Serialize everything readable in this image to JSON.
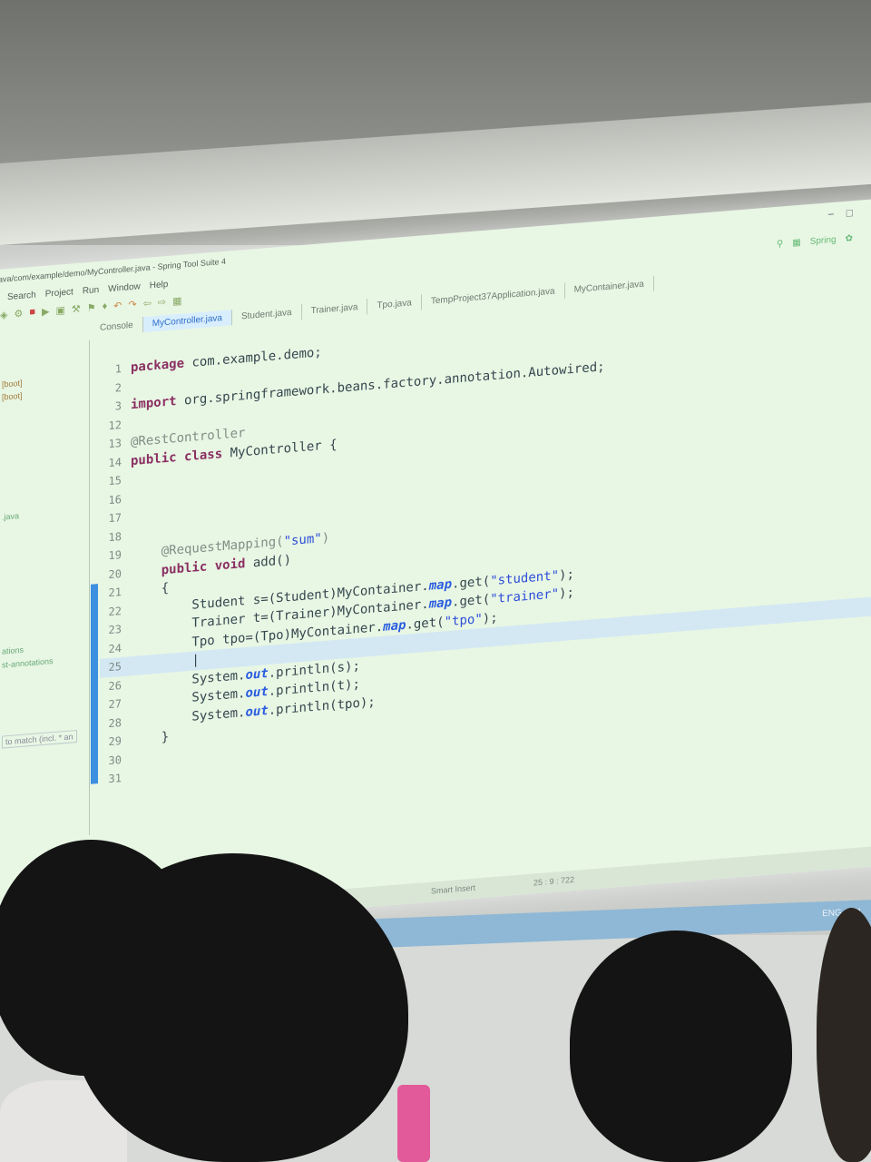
{
  "window": {
    "title": "ava/com/example/demo/MyController.java - Spring Tool Suite 4",
    "window_controls": [
      "−",
      "□"
    ]
  },
  "menu": [
    "Search",
    "Project",
    "Run",
    "Window",
    "Help"
  ],
  "perspective": {
    "label": "Spring",
    "icons": [
      "search-icon",
      "layout-icon",
      "spring-icon"
    ]
  },
  "tabs": [
    {
      "label": "Console",
      "active": false
    },
    {
      "label": "MyController.java",
      "active": true
    },
    {
      "label": "Student.java",
      "active": false
    },
    {
      "label": "Trainer.java",
      "active": false
    },
    {
      "label": "Tpo.java",
      "active": false
    },
    {
      "label": "TempProject37Application.java",
      "active": false
    },
    {
      "label": "MyContainer.java",
      "active": false
    }
  ],
  "left_panel": {
    "items": [
      "[boot]",
      "[boot]",
      ".java",
      "ations",
      "st-annotations"
    ],
    "filter_placeholder": "to match (incl. * an"
  },
  "code": {
    "lines": [
      {
        "n": "1",
        "tokens": [
          [
            "kw",
            "package"
          ],
          [
            "txt",
            " com.example.demo;"
          ]
        ]
      },
      {
        "n": "2",
        "tokens": []
      },
      {
        "n": "3",
        "tokens": [
          [
            "kw",
            "import"
          ],
          [
            "txt",
            " org.springframework.beans.factory.annotation.Autowired;"
          ]
        ]
      },
      {
        "n": "12",
        "tokens": []
      },
      {
        "n": "13",
        "tokens": [
          [
            "ann",
            "@RestController"
          ]
        ]
      },
      {
        "n": "14",
        "tokens": [
          [
            "kw",
            "public class"
          ],
          [
            "txt",
            " MyController {"
          ]
        ]
      },
      {
        "n": "15",
        "tokens": []
      },
      {
        "n": "16",
        "tokens": []
      },
      {
        "n": "17",
        "tokens": []
      },
      {
        "n": "18",
        "tokens": []
      },
      {
        "n": "19",
        "tokens": [
          [
            "txt",
            "    "
          ],
          [
            "ann",
            "@RequestMapping("
          ],
          [
            "str",
            "\"sum\""
          ],
          [
            "ann",
            ")"
          ]
        ]
      },
      {
        "n": "20",
        "tokens": [
          [
            "txt",
            "    "
          ],
          [
            "kw",
            "public void"
          ],
          [
            "txt",
            " add()"
          ]
        ]
      },
      {
        "n": "21",
        "tokens": [
          [
            "txt",
            "    {"
          ]
        ]
      },
      {
        "n": "22",
        "tokens": [
          [
            "txt",
            "        Student s=(Student)MyContainer."
          ],
          [
            "fld",
            "map"
          ],
          [
            "txt",
            ".get("
          ],
          [
            "str",
            "\"student\""
          ],
          [
            "txt",
            ");"
          ]
        ]
      },
      {
        "n": "23",
        "tokens": [
          [
            "txt",
            "        Trainer t=(Trainer)MyContainer."
          ],
          [
            "fld",
            "map"
          ],
          [
            "txt",
            ".get("
          ],
          [
            "str",
            "\"trainer\""
          ],
          [
            "txt",
            ");"
          ]
        ]
      },
      {
        "n": "24",
        "tokens": [
          [
            "txt",
            "        Tpo tpo=(Tpo)MyContainer."
          ],
          [
            "fld",
            "map"
          ],
          [
            "txt",
            ".get("
          ],
          [
            "str",
            "\"tpo\""
          ],
          [
            "txt",
            ");"
          ]
        ]
      },
      {
        "n": "25",
        "tokens": [
          [
            "txt",
            "        |"
          ]
        ],
        "current": true
      },
      {
        "n": "26",
        "tokens": [
          [
            "txt",
            "        System."
          ],
          [
            "fld",
            "out"
          ],
          [
            "txt",
            ".println(s);"
          ]
        ]
      },
      {
        "n": "27",
        "tokens": [
          [
            "txt",
            "        System."
          ],
          [
            "fld",
            "out"
          ],
          [
            "txt",
            ".println(t);"
          ]
        ]
      },
      {
        "n": "28",
        "tokens": [
          [
            "txt",
            "        System."
          ],
          [
            "fld",
            "out"
          ],
          [
            "txt",
            ".println(tpo);"
          ]
        ]
      },
      {
        "n": "29",
        "tokens": [
          [
            "txt",
            "    }"
          ]
        ]
      },
      {
        "n": "30",
        "tokens": []
      },
      {
        "n": "31",
        "tokens": []
      }
    ]
  },
  "status": {
    "mode": "Smart Insert",
    "position": "25 : 9 : 722"
  },
  "taskbar": {
    "tray": "ENG  12:1"
  },
  "colors": {
    "screen_bg": "#e8f6e4",
    "keyword": "#8a2f62",
    "string": "#2d4fd8",
    "active_tab": "#2f6ec8",
    "change_bar": "#3d8fe0"
  }
}
